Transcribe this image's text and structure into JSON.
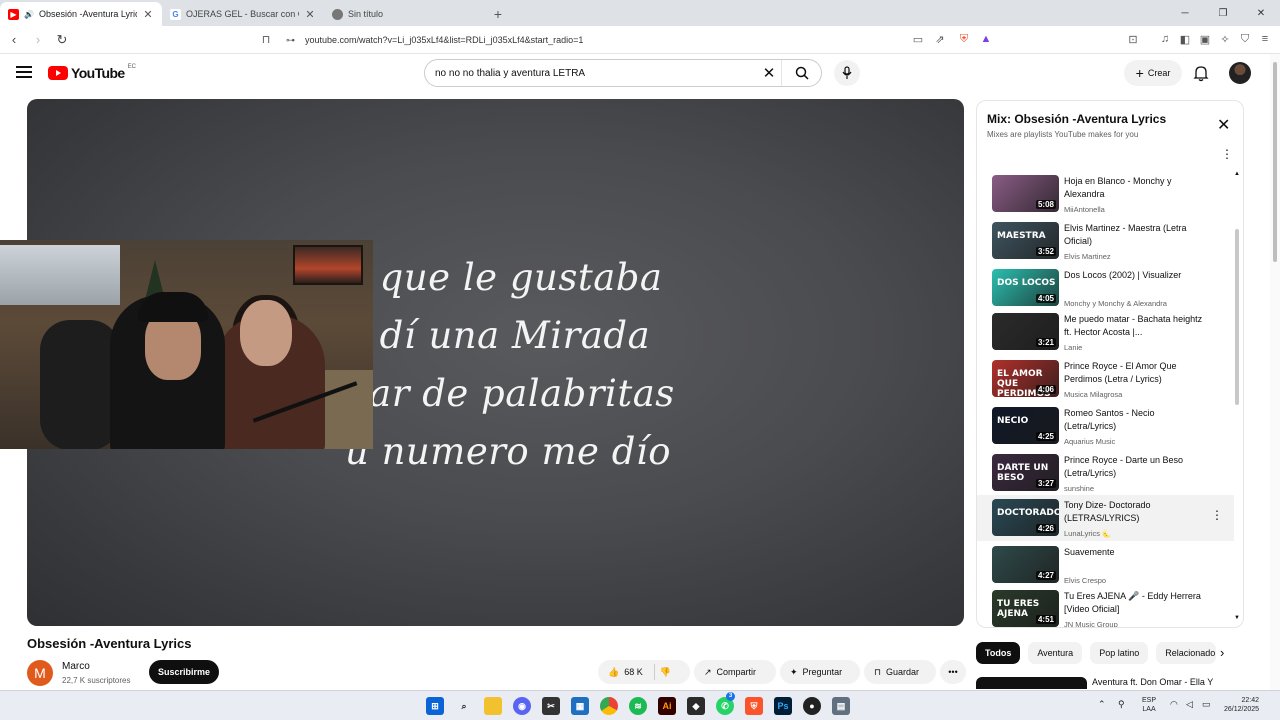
{
  "browser": {
    "tabs": [
      {
        "title": "Obsesión -Aventura Lyrics - Y",
        "favicon": "youtube-icon",
        "active": true
      },
      {
        "title": "OJERAS GEL - Buscar con Google",
        "favicon": "google-icon",
        "active": false
      },
      {
        "title": "Sin título",
        "favicon": "globe-icon",
        "active": false
      }
    ],
    "url": "youtube.com/watch?v=Li_j035xLf4&list=RDLi_j035xLf4&start_radio=1"
  },
  "header": {
    "logo": "YouTube",
    "country": "EC",
    "search_query": "no no no thalia y aventura LETRA",
    "create_label": "Crear"
  },
  "player": {
    "lyrics": [
      "e que le gustaba",
      "e dí una Mirada",
      "par de palabritas",
      "u numero me dío"
    ]
  },
  "video": {
    "title": "Obsesión -Aventura Lyrics",
    "channel": "Marco",
    "channel_initial": "M",
    "subscribers": "22,7 K suscriptores",
    "subscribe_label": "Suscribirme",
    "likes": "68 K",
    "share_label": "Compartir",
    "ask_label": "Preguntar",
    "save_label": "Guardar"
  },
  "mix": {
    "title": "Mix: Obsesión -Aventura Lyrics",
    "subtitle": "Mixes are playlists YouTube makes for you",
    "items": [
      {
        "title": "Hoja en Blanco - Monchy y Alexandra",
        "channel": "MiiAntonella",
        "duration": "5:08",
        "thumb_text": "",
        "color": "#8a5c86"
      },
      {
        "title": "Elvis Martinez - Maestra (Letra Oficial)",
        "channel": "Elvis Martinez",
        "duration": "3:52",
        "thumb_text": "MAESTRA",
        "color": "#3f5560"
      },
      {
        "title": "Dos Locos (2002) | Visualizer",
        "channel": "Monchy y Monchy & Alexandra",
        "duration": "4:05",
        "thumb_text": "DOS LOCOS",
        "color": "#2bbfb0"
      },
      {
        "title": "Me puedo matar - Bachata heightz ft. Hector Acosta |...",
        "channel": "Lanie",
        "duration": "3:21",
        "thumb_text": "",
        "color": "#2b2b2b"
      },
      {
        "title": "Prince Royce - El Amor Que Perdimos (Letra / Lyrics)",
        "channel": "Musica Milagrosa",
        "duration": "4:06",
        "thumb_text": "EL AMOR QUE PERDIMOS",
        "color": "#b0302b"
      },
      {
        "title": "Romeo Santos - Necio (Letra/Lyrics)",
        "channel": "Aquarius Music",
        "duration": "4:25",
        "thumb_text": "NECIO",
        "color": "#101828"
      },
      {
        "title": "Prince Royce - Darte un Beso (Letra/Lyrics)",
        "channel": "sunshine",
        "duration": "3:27",
        "thumb_text": "DARTE UN BESO",
        "color": "#3a2a3f"
      },
      {
        "title": "Tony Dize- Doctorado (LETRAS/LYRICS)",
        "channel": "LunaLyrics 🌜",
        "duration": "4:26",
        "thumb_text": "DOCTORADO",
        "color": "#2a4a55"
      },
      {
        "title": "Suavemente",
        "channel": "Elvis Crespo",
        "duration": "4:27",
        "thumb_text": "",
        "color": "#2f4a4a"
      },
      {
        "title": "Tu Eres AJENA 🎤 - Eddy Herrera [Video Oficial]",
        "channel": "JN Music Group",
        "duration": "4:51",
        "thumb_text": "TU ERES AJENA",
        "color": "#2a3a2a"
      }
    ]
  },
  "chips": [
    "Todos",
    "Aventura",
    "Pop latino",
    "Relacionado"
  ],
  "next_video_title": "Aventura ft. Don Omar - Ella Y",
  "taskbar": {
    "lang": "ESP",
    "layout": "LAA",
    "time": "22:42",
    "date": "26/12/2025",
    "whatsapp_badge": "3"
  }
}
